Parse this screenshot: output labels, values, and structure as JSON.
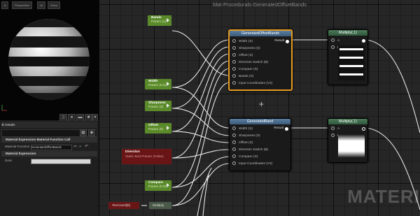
{
  "viewport": {
    "perspective_label": "Perspective",
    "lit_label": "Lit",
    "show_label": "Show"
  },
  "details": {
    "tab_label": "Details",
    "section_function_call": "Material Expression Material Function Call",
    "material_function_label": "Material Function",
    "material_function_value": "GeneratedOffsetBands",
    "section_expression": "Material Expression",
    "desc_label": "Desc"
  },
  "graph": {
    "title": "Mat-Procedurals-GeneratedOffsetBands",
    "watermark": "MATERI"
  },
  "params": {
    "bands": {
      "title": "Bands",
      "sub": "Param (1)"
    },
    "width": {
      "title": "Width",
      "sub": "Param (0.5)"
    },
    "sharpness": {
      "title": "Sharpness",
      "sub": "Param (2)"
    },
    "offset": {
      "title": "Offset",
      "sub": "Param (0)"
    },
    "direction": {
      "title": "Direction",
      "sub": "Static Bool Param (False)"
    },
    "compare": {
      "title": "Compare",
      "sub": "Param (0.5)"
    },
    "texcoord": {
      "title": "TexCoord[0]"
    },
    "multiply_small": {
      "title": "Multiply"
    }
  },
  "node_offset_bands": {
    "title": "GeneratedOffsetBands",
    "inputs": [
      "Width (S)",
      "Sharpness (S)",
      "Offset (S)",
      "Direction Switch (B)",
      "Compare (S)",
      "Bands (S)",
      "Input Coordinates (V2)"
    ],
    "output": "Result"
  },
  "node_band": {
    "title": "GeneratedBand",
    "inputs": [
      "Width (S)",
      "Sharpness (S)",
      "Offset (S)",
      "Direction Switch (B)",
      "Compare (S)",
      "Input Coordinates (V2)"
    ],
    "output": "Result"
  },
  "multiply1": {
    "title": "Multiply(,1)",
    "a": "A",
    "b": "B"
  },
  "multiply2": {
    "title": "Multiply(,1)",
    "a": "A",
    "b": "B"
  }
}
